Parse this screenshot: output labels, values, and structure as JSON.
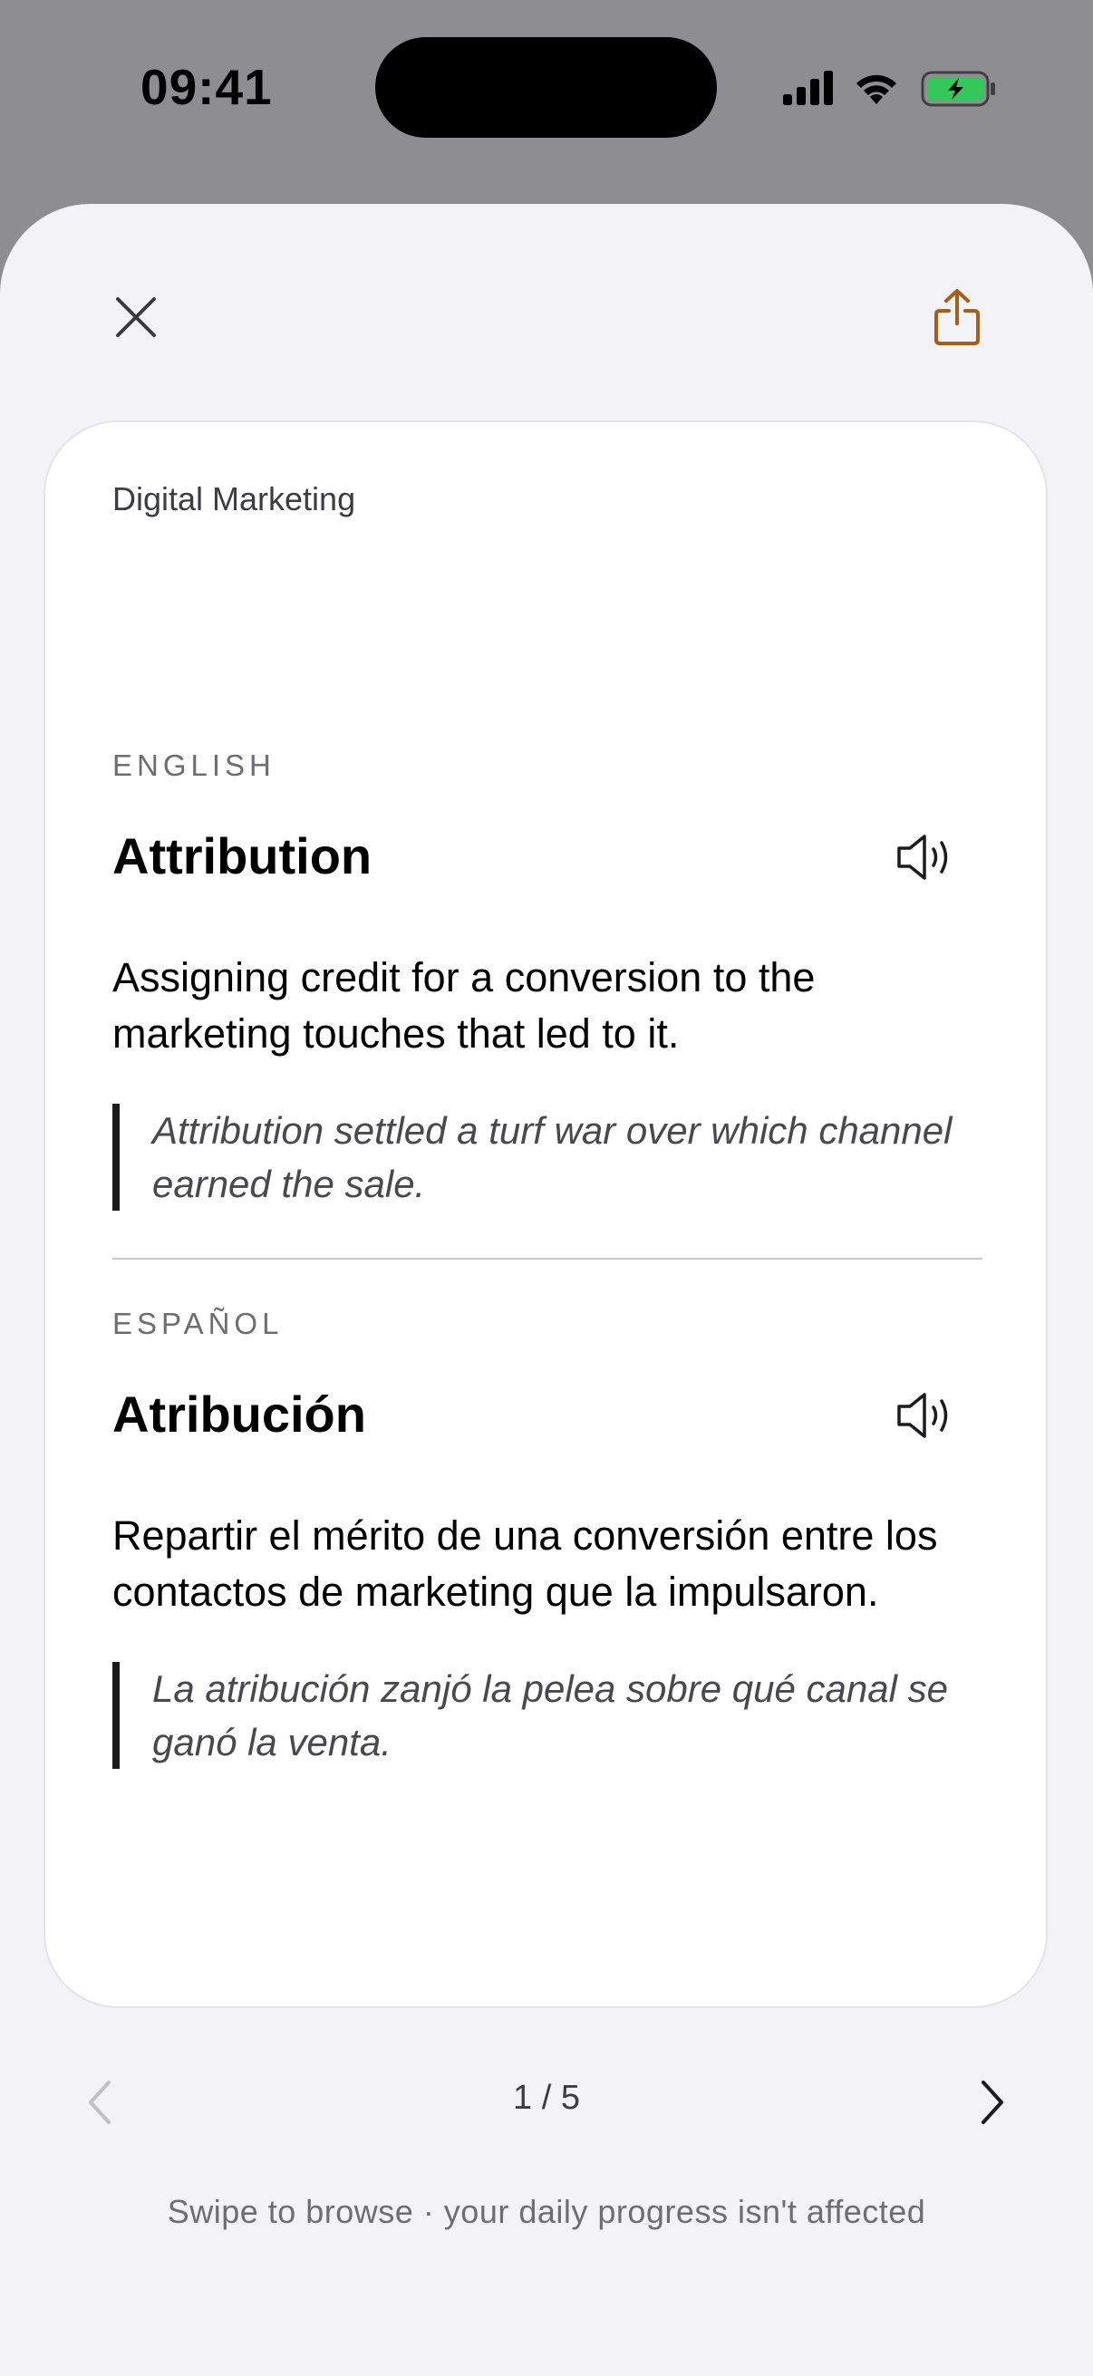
{
  "status_bar": {
    "time": "09:41",
    "icons": [
      "cellular-signal-icon",
      "wifi-icon",
      "battery-charging-icon"
    ],
    "battery_color": "#34c759"
  },
  "header": {
    "close_icon": "close-icon",
    "share_icon": "share-icon",
    "accent_color": "#a2601a"
  },
  "card": {
    "category": "Digital Marketing",
    "english": {
      "label": "ENGLISH",
      "term": "Attribution",
      "definition": "Assigning credit for a conversion to the marketing touches that led to it.",
      "example": "Attribution settled a turf war over which channel earned the sale."
    },
    "spanish": {
      "label": "ESPAÑOL",
      "term": "Atribución",
      "definition": "Repartir el mérito de una conversión entre los contactos de marketing que la impulsaron.",
      "example": "La atribución zanjó la pelea sobre qué canal se ganó la venta."
    }
  },
  "pager": {
    "indicator": "1 / 5",
    "prev_enabled": false,
    "next_enabled": true
  },
  "footer": {
    "hint": "Swipe to browse · your daily progress isn't affected"
  }
}
